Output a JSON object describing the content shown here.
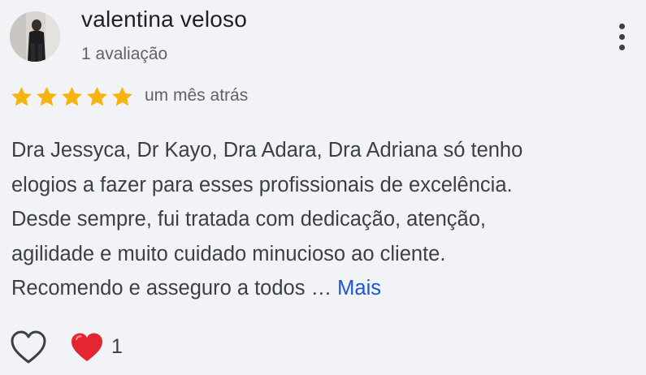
{
  "review": {
    "author_name": "valentina veloso",
    "review_count": "1 avaliação",
    "rating": 5,
    "rating_max": 5,
    "date": "um mês atrás",
    "text_lines": [
      "Dra Jessyca, Dr Kayo, Dra Adara, Dra Adriana só tenho",
      "elogios a fazer para esses profissionais de excelência.",
      "Desde sempre, fui tratada com dedicação, atenção,",
      "agilidade e muito cuidado minucioso ao cliente.",
      "Recomendo e asseguro a todos …"
    ],
    "more_link": "Mais",
    "reaction_count": "1"
  },
  "icons": {
    "avatar": "profile-photo",
    "menu": "more-vert-icon",
    "star": "star-icon",
    "like": "heart-outline-icon",
    "reaction": "red-heart-icon"
  },
  "colors": {
    "background": "#f1f3f6",
    "star": "#f7b40e",
    "link": "#1a57d6",
    "heart": "#e3262f",
    "text": "#3c4043"
  }
}
